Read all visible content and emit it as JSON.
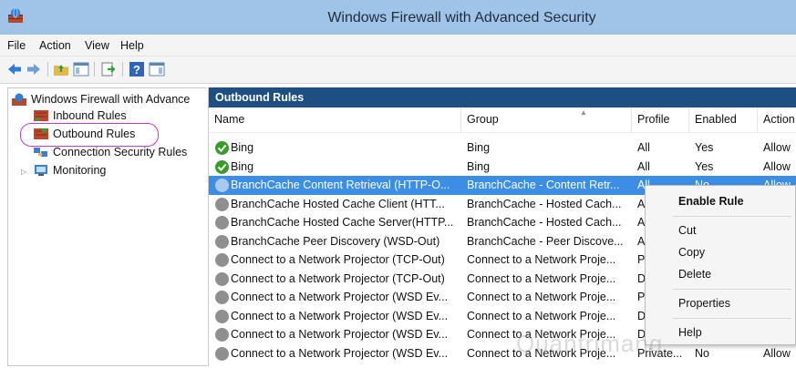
{
  "window": {
    "title": "Windows Firewall with Advanced Security"
  },
  "menu": [
    "File",
    "Action",
    "View",
    "Help"
  ],
  "tree": {
    "root": "Windows Firewall with Advance",
    "items": [
      "Inbound Rules",
      "Outbound Rules",
      "Connection Security Rules",
      "Monitoring"
    ]
  },
  "pane": {
    "title": "Outbound Rules",
    "columns": [
      "Name",
      "Group",
      "Profile",
      "Enabled",
      "Action"
    ],
    "rows": [
      {
        "name": "Bing",
        "group": "Bing",
        "profile": "All",
        "enabled": "Yes",
        "action": "Allow",
        "state": "enabled"
      },
      {
        "name": "Bing",
        "group": "Bing",
        "profile": "All",
        "enabled": "Yes",
        "action": "Allow",
        "state": "enabled"
      },
      {
        "name": "BranchCache Content Retrieval (HTTP-O...",
        "group": "BranchCache - Content Retr...",
        "profile": "All",
        "enabled": "No",
        "action": "Allow",
        "state": "disabled",
        "selected": true
      },
      {
        "name": "BranchCache Hosted Cache Client (HTT...",
        "group": "BranchCache - Hosted Cach...",
        "profile": "A",
        "enabled": "",
        "action": "",
        "state": "disabled"
      },
      {
        "name": "BranchCache Hosted Cache Server(HTTP...",
        "group": "BranchCache - Hosted Cach...",
        "profile": "A",
        "enabled": "",
        "action": "",
        "state": "disabled"
      },
      {
        "name": "BranchCache Peer Discovery (WSD-Out)",
        "group": "BranchCache - Peer Discove...",
        "profile": "A",
        "enabled": "",
        "action": "",
        "state": "disabled"
      },
      {
        "name": "Connect to a Network Projector (TCP-Out)",
        "group": "Connect to a Network Proje...",
        "profile": "P",
        "enabled": "",
        "action": "",
        "state": "disabled"
      },
      {
        "name": "Connect to a Network Projector (TCP-Out)",
        "group": "Connect to a Network Proje...",
        "profile": "D",
        "enabled": "",
        "action": "",
        "state": "disabled"
      },
      {
        "name": "Connect to a Network Projector (WSD Ev...",
        "group": "Connect to a Network Proje...",
        "profile": "P",
        "enabled": "",
        "action": "",
        "state": "disabled"
      },
      {
        "name": "Connect to a Network Projector (WSD Ev...",
        "group": "Connect to a Network Proje...",
        "profile": "D",
        "enabled": "",
        "action": "",
        "state": "disabled"
      },
      {
        "name": "Connect to a Network Projector (WSD Ev...",
        "group": "Connect to a Network Proje...",
        "profile": "D",
        "enabled": "",
        "action": "",
        "state": "disabled"
      },
      {
        "name": "Connect to a Network Projector (WSD Ev...",
        "group": "Connect to a Network Proje...",
        "profile": "Private...",
        "enabled": "No",
        "action": "Allow",
        "state": "disabled"
      }
    ]
  },
  "context_menu": {
    "enable_rule": "Enable Rule",
    "cut": "Cut",
    "copy": "Copy",
    "delete": "Delete",
    "properties": "Properties",
    "help": "Help"
  },
  "watermark": "Quantrimang",
  "colors": {
    "titlebar": "#9fc4e7",
    "pane_header": "#1d4f82",
    "selection": "#3b8ee3",
    "enabled_icon": "#3a9c2b",
    "disabled_icon": "#8f8f8f",
    "annotation_ring": "#c43cc4"
  }
}
